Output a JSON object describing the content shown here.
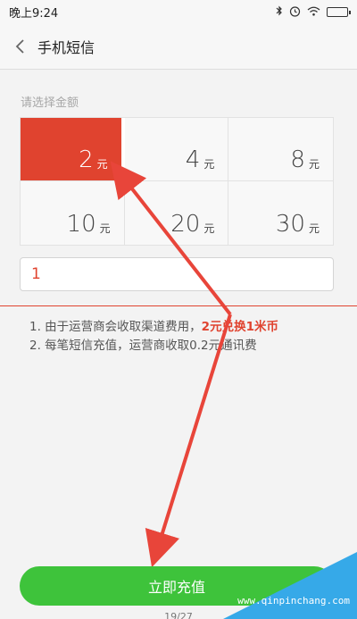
{
  "status_bar": {
    "time": "晚上9:24",
    "icons": [
      "bluetooth-icon",
      "alarm-icon",
      "wifi-icon",
      "battery-icon"
    ]
  },
  "nav": {
    "title": "手机短信"
  },
  "amount_section": {
    "label": "请选择金额",
    "unit": "元",
    "options": [
      {
        "value": "2",
        "selected": true
      },
      {
        "value": "4",
        "selected": false
      },
      {
        "value": "8",
        "selected": false
      },
      {
        "value": "10",
        "selected": false
      },
      {
        "value": "20",
        "selected": false
      },
      {
        "value": "30",
        "selected": false
      }
    ]
  },
  "quantity_input": {
    "value": "1"
  },
  "notes": {
    "line1_prefix": "1. 由于运营商会收取渠道费用，",
    "line1_highlight": "2元兑换1米币",
    "line2": "2. 每笔短信充值，运营商收取0.2元通讯费"
  },
  "recharge_button": {
    "label": "立即充值"
  },
  "page_indicator": "19/27",
  "watermark": "www.qinpinchang.com",
  "colors": {
    "accent_red": "#e0432f",
    "button_green": "#3ec33b",
    "watermark_blue": "#36a9e8"
  }
}
